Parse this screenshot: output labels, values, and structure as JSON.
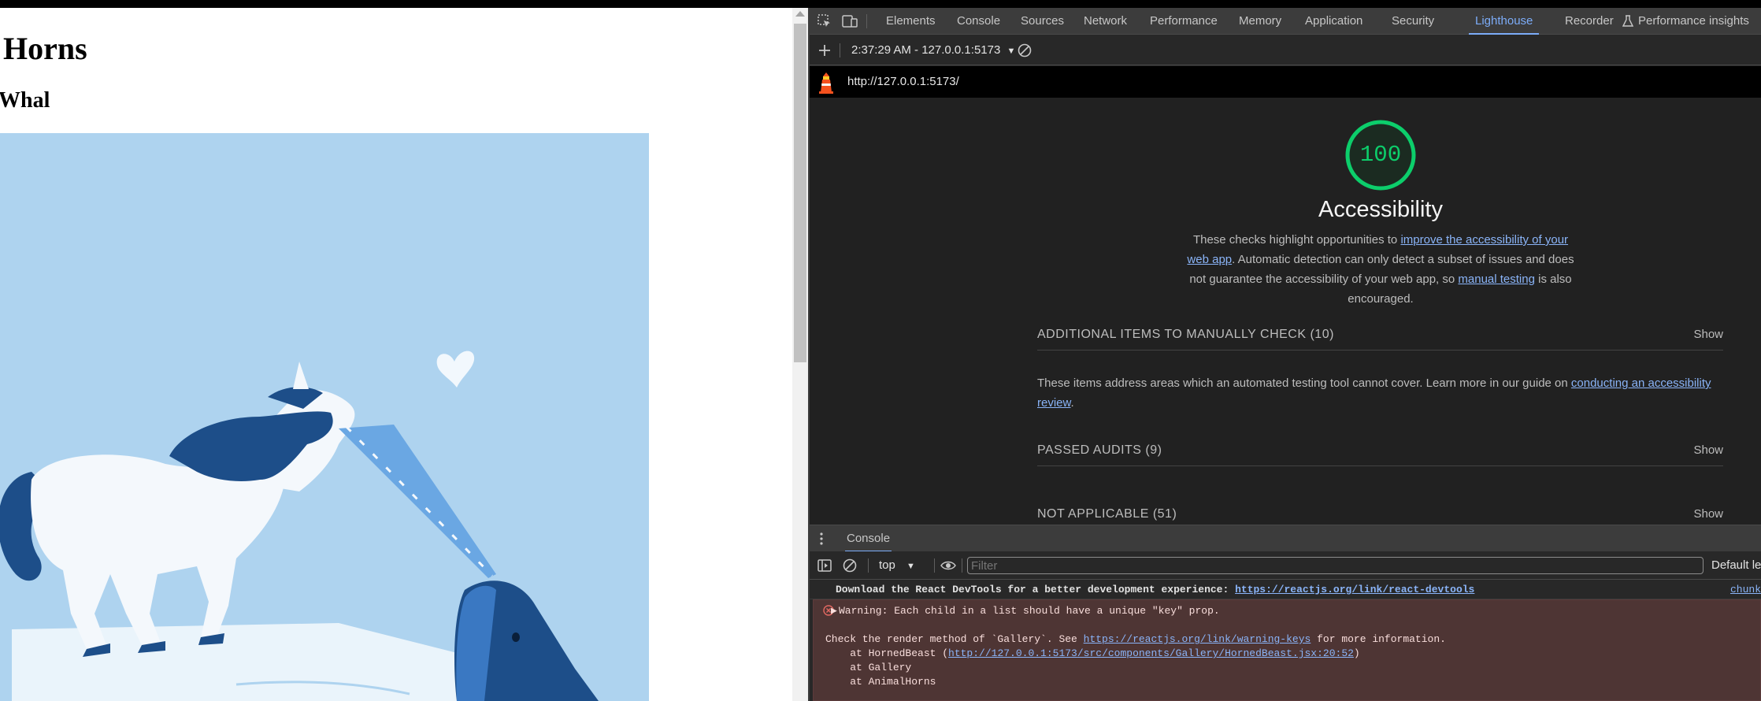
{
  "page": {
    "title": "Horns",
    "subtitle": "Whal"
  },
  "devtools": {
    "tabs": [
      "Elements",
      "Console",
      "Sources",
      "Network",
      "Performance",
      "Memory",
      "Application",
      "Security",
      "Lighthouse",
      "Recorder",
      "Performance insights"
    ],
    "active_tab": "Lighthouse",
    "report_selector": "2:37:29 AM - 127.0.0.1:5173",
    "report_url": "http://127.0.0.1:5173/",
    "lighthouse": {
      "score": "100",
      "score_color": "#0cce6b",
      "category": "Accessibility",
      "desc_pre": "These checks highlight opportunities to ",
      "desc_link1": "improve the accessibility of your web app",
      "desc_mid": ". Automatic detection can only detect a subset of issues and does not guarantee the accessibility of your web app, so ",
      "desc_link2": "manual testing",
      "desc_post": " is also encouraged.",
      "groups": [
        {
          "title": "ADDITIONAL ITEMS TO MANUALLY CHECK (10)",
          "action": "Show"
        },
        {
          "title": "PASSED AUDITS (9)",
          "action": "Show"
        },
        {
          "title": "NOT APPLICABLE (51)",
          "action": "Show"
        }
      ],
      "manual_desc_pre": "These items address areas which an automated testing tool cannot cover. Learn more in our guide on ",
      "manual_desc_link": "conducting an accessibility review",
      "manual_desc_post": "."
    },
    "drawer": {
      "tab": "Console",
      "context": "top",
      "filter_placeholder": "Filter",
      "levels": "Default levels",
      "messages": {
        "info_text": "Download the React DevTools for a better development experience: ",
        "info_link": "https://reactjs.org/link/react-devtools",
        "info_source": "chunk",
        "warning_head": "Warning: Each child in a list should have a unique \"key\" prop.",
        "check_pre": "Check the render method of `Gallery`. See ",
        "check_link": "https://reactjs.org/link/warning-keys",
        "check_post": " for more information.",
        "stack1_pre": "    at HornedBeast (",
        "stack1_link": "http://127.0.0.1:5173/src/components/Gallery/HornedBeast.jsx:20:52",
        "stack1_post": ")",
        "stack2": "    at Gallery",
        "stack3": "    at AnimalHorns"
      }
    }
  }
}
